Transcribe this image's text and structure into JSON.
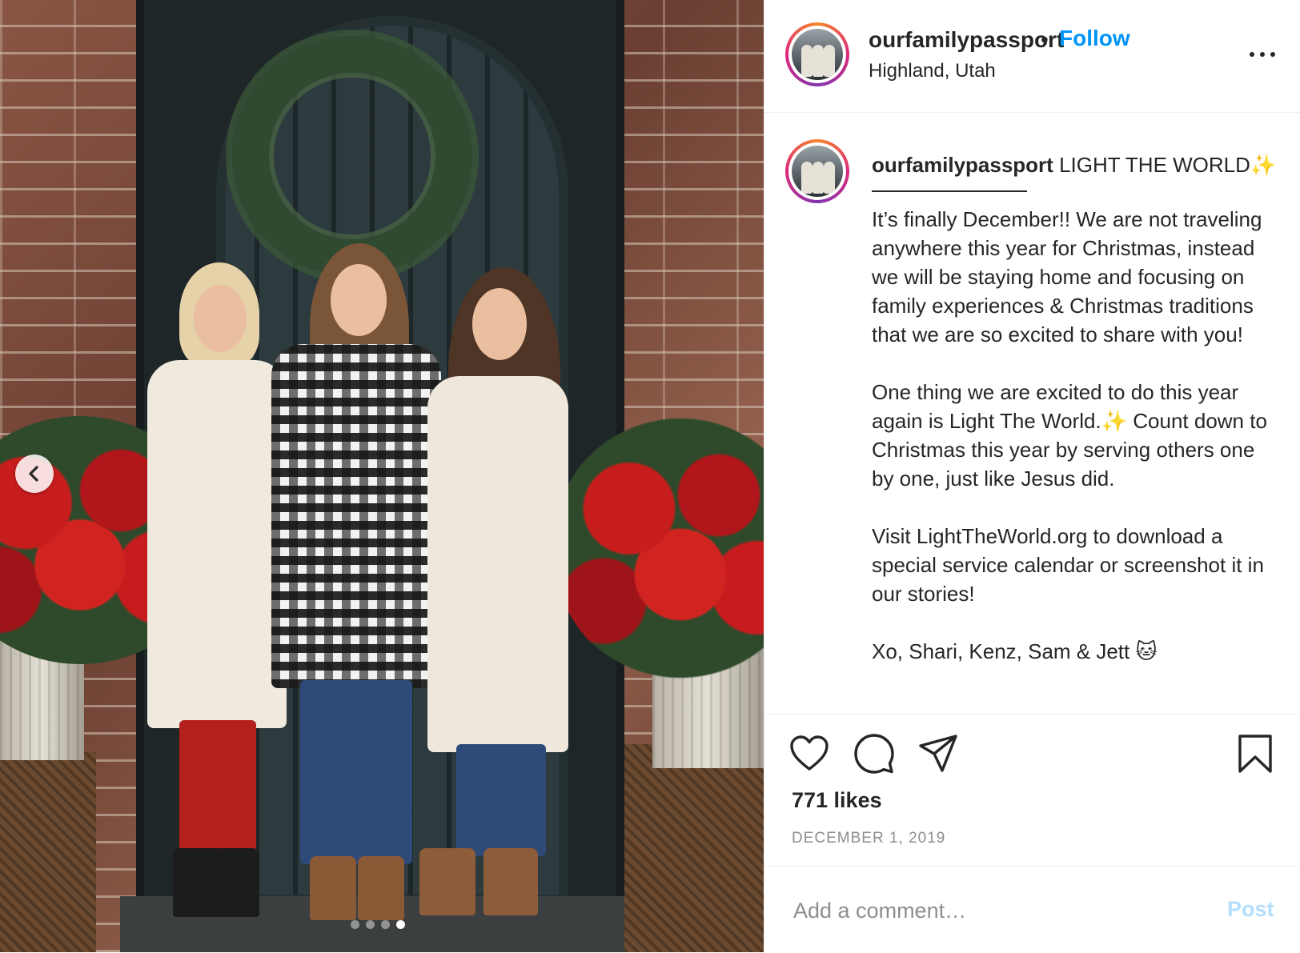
{
  "header": {
    "username": "ourfamilypassport",
    "separator": "•",
    "follow_label": "Follow",
    "location": "Highland, Utah",
    "more_icon": "more-horizontal-icon"
  },
  "caption": {
    "username": "ourfamilypassport",
    "title": "LIGHT THE WORLD",
    "title_emoji": "✨",
    "paragraph1": "It’s finally December!! We are not traveling anywhere this year for Christmas, instead we will be staying home and focusing on family experiences & Christmas traditions that we are so excited to share with you!",
    "paragraph2_start": "One thing we are excited to do this year again is Light The World.",
    "paragraph2_emoji": "✨",
    "paragraph2_end": " Count down to Christmas this year by serving others one by one, just like Jesus did.",
    "paragraph3": "Visit LightTheWorld.org to download a special service calendar or screenshot it in our stories!",
    "paragraph4_partial": "Xo, Shari, Kenz, Sam & Jett 🐱"
  },
  "actions": {
    "like_icon": "heart-icon",
    "comment_icon": "comment-icon",
    "share_icon": "paper-plane-icon",
    "save_icon": "bookmark-icon",
    "likes": "771 likes",
    "date": "DECEMBER 1, 2019"
  },
  "comment": {
    "placeholder": "Add a comment…",
    "post_label": "Post"
  },
  "carousel": {
    "prev_icon": "chevron-left-icon",
    "slide_count": 4,
    "active_index": 3
  },
  "colors": {
    "follow": "#0095f6",
    "post_disabled": "#b2dffc",
    "secondary_text": "#8e8e8e",
    "divider": "#efefef"
  }
}
